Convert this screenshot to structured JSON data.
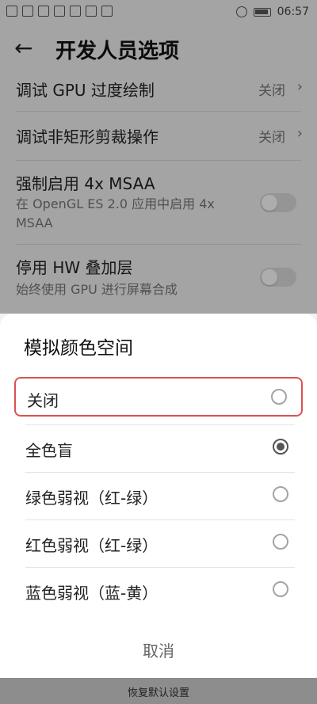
{
  "status_bar": {
    "time": "06:57"
  },
  "header": {
    "title": "开发人员选项",
    "back_icon": "←"
  },
  "settings": {
    "gpu_overdraw": {
      "title": "调试 GPU 过度绘制",
      "value": "关闭"
    },
    "nonrect_clip": {
      "title": "调试非矩形剪裁操作",
      "value": "关闭"
    },
    "force_msaa": {
      "title": "强制启用 4x MSAA",
      "subtitle": "在 OpenGL ES 2.0 应用中启用 4x MSAA"
    },
    "disable_hw_overlay": {
      "title": "停用 HW 叠加层",
      "subtitle": "始终使用 GPU 进行屏幕合成"
    }
  },
  "sheet": {
    "title": "模拟颜色空间",
    "options": [
      {
        "label": "关闭",
        "selected": false
      },
      {
        "label": "全色盲",
        "selected": true
      },
      {
        "label": "绿色弱视（红-绿）",
        "selected": false
      },
      {
        "label": "红色弱视（红-绿）",
        "selected": false
      },
      {
        "label": "蓝色弱视（蓝-黄）",
        "selected": false
      }
    ],
    "cancel": "取消"
  },
  "footer": {
    "restore_defaults": "恢复默认设置"
  },
  "colors": {
    "highlight_border": "#d9534f",
    "sheet_bg": "#ffffff",
    "overlay": "rgba(0,0,0,0.32)"
  }
}
